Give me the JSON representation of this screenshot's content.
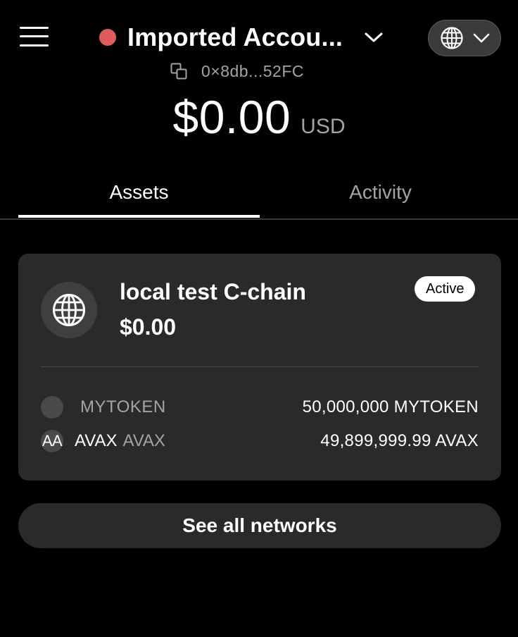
{
  "header": {
    "account_name": "Imported Accou...",
    "status_color": "#e05c5c",
    "menu_icon": "hamburger-menu-icon",
    "network_icon": "globe-icon"
  },
  "address": {
    "short": "0×8db...52FC",
    "copy_icon": "copy-icon"
  },
  "balance": {
    "value": "$0.00",
    "currency": "USD"
  },
  "tabs": [
    {
      "label": "Assets",
      "active": true
    },
    {
      "label": "Activity",
      "active": false
    }
  ],
  "network_card": {
    "name": "local test C-chain",
    "balance": "$0.00",
    "badge": "Active",
    "logo_icon": "globe-icon",
    "tokens": [
      {
        "icon_text": "",
        "name": "",
        "symbol": "MYTOKEN",
        "amount": "50,000,000 MYTOKEN"
      },
      {
        "icon_text": "AA",
        "name": "AVAX",
        "symbol": "AVAX",
        "amount": "49,899,999.99 AVAX"
      }
    ]
  },
  "see_all_label": "See all networks"
}
